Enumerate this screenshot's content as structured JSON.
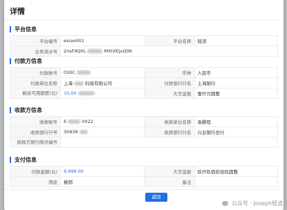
{
  "dialog": {
    "title": "详情",
    "confirm_label": "返回"
  },
  "platform": {
    "title": "平台信息",
    "platform_no_label": "平台编号",
    "platform_no": "exiao001",
    "platform_name_label": "平台名称",
    "platform_name": "轻流",
    "serial_no_label": "业务流水号",
    "serial_no_prefix": "2nsF9Q0L",
    "serial_no_suffix": "MXtXEjxzDN"
  },
  "payer": {
    "title": "付款方信息",
    "account_label": "付款账号",
    "account": "030C",
    "currency_label": "币种",
    "currency": "人民币",
    "unit_label": "付款单位名称",
    "unit_prefix": "上海",
    "unit_suffix": "科技有限公司",
    "bank_label": "付款银行行名",
    "bank": "上海银行",
    "balance_label": "剩余可用额度(元)",
    "balance_prefix": "10,00",
    "amount_upper_label": "大写金额",
    "amount_upper": "壹仟万圆整"
  },
  "payee": {
    "title": "收款方信息",
    "account_label": "收款账号",
    "account_prefix": "6",
    "account_suffix": "0022",
    "unit_label": "收款单位名称",
    "unit": "袁鹏程",
    "bank_no_label": "收款银行行号",
    "bank_no": "30939",
    "bank_name_label": "收款银行行名",
    "bank_name": "兴业银行总行",
    "branch_label": "收款方银行网点编号",
    "branch": ""
  },
  "payment": {
    "title": "支付信息",
    "amount_label": "付款金额(元)",
    "amount": "9,999.00",
    "amount_upper_label": "大写金额",
    "amount_upper": "玖仟玖佰玖拾玖圆整",
    "usage_label": "用途",
    "usage": "报销",
    "remark_label": "备注",
    "remark": ""
  },
  "watermark": {
    "text": "公众号 · Joseph轻流"
  },
  "colors": {
    "accent": "#1f6fe5",
    "label_bg": "#f6f7f9",
    "border": "#ececec"
  }
}
